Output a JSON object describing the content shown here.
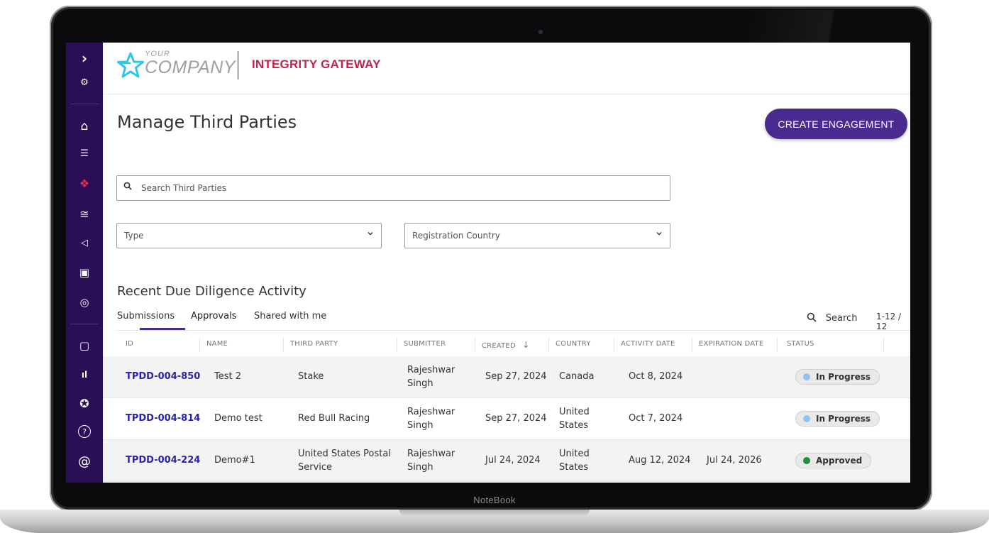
{
  "device": {
    "brand_label": "NoteBook"
  },
  "sidebar": {
    "items": [
      {
        "icon": "chevron-right-icon",
        "glyph": "›"
      },
      {
        "icon": "user-settings-icon",
        "glyph": "⚙"
      },
      {
        "icon": "home-icon",
        "glyph": "⌂"
      },
      {
        "icon": "checklist-icon",
        "glyph": "☰"
      },
      {
        "icon": "handshake-icon",
        "glyph": "❖"
      },
      {
        "icon": "layers-icon",
        "glyph": "≅"
      },
      {
        "icon": "megaphone-icon",
        "glyph": "◁"
      },
      {
        "icon": "money-icon",
        "glyph": "▣"
      },
      {
        "icon": "globe-search-icon",
        "glyph": "◎"
      },
      {
        "icon": "document-check-icon",
        "glyph": "▢"
      },
      {
        "icon": "bar-chart-icon",
        "glyph": "ıl"
      },
      {
        "icon": "shield-star-icon",
        "glyph": "✪"
      },
      {
        "icon": "help-icon",
        "glyph": "?"
      },
      {
        "icon": "at-sign-icon",
        "glyph": "@"
      }
    ]
  },
  "header": {
    "logo_small": "YOUR",
    "logo_large": "COMPANY",
    "product_name": "INTEGRITY GATEWAY"
  },
  "page": {
    "title": "Manage Third Parties",
    "create_button": "CREATE ENGAGEMENT",
    "search_placeholder": "Search Third Parties",
    "filter_type": "Type",
    "filter_country": "Registration Country"
  },
  "activity": {
    "title": "Recent Due Diligence Activity",
    "tabs": [
      "Submissions",
      "Approvals",
      "Shared with me"
    ],
    "active_tab": "Approvals",
    "search_label": "Search",
    "pager": "1-12 / 12",
    "columns": [
      "ID",
      "NAME",
      "THIRD PARTY",
      "SUBMITTER",
      "CREATED",
      "COUNTRY",
      "ACTIVITY DATE",
      "EXPIRATION DATE",
      "STATUS"
    ],
    "sort_indicator": "↓",
    "rows": [
      {
        "id": "TPDD-004-850",
        "name": "Test 2",
        "third_party": [
          "Stake"
        ],
        "submitter": [
          "Rajeshwar",
          "Singh"
        ],
        "created": "Sep 27, 2024",
        "country": [
          "Canada"
        ],
        "activity_date": "Oct 8, 2024",
        "expiration_date": "",
        "status": "In Progress",
        "status_color": "#8fc4f2"
      },
      {
        "id": "TPDD-004-814",
        "name": "Demo test",
        "third_party": [
          "Red Bull Racing"
        ],
        "submitter": [
          "Rajeshwar",
          "Singh"
        ],
        "created": "Sep 27, 2024",
        "country": [
          "United",
          "States"
        ],
        "activity_date": "Oct 7, 2024",
        "expiration_date": "",
        "status": "In Progress",
        "status_color": "#8fc4f2"
      },
      {
        "id": "TPDD-004-224",
        "name": "Demo#1",
        "third_party": [
          "United States Postal",
          "Service"
        ],
        "submitter": [
          "Rajeshwar",
          "Singh"
        ],
        "created": "Jul 24, 2024",
        "country": [
          "United",
          "States"
        ],
        "activity_date": "Aug 12, 2024",
        "expiration_date": "Jul 24, 2026",
        "status": "Approved",
        "status_color": "#1e8e3e"
      }
    ]
  },
  "colors": {
    "sidebar_bg": "#2a0f57",
    "accent": "#4b2a8f",
    "brand_red": "#c3224a",
    "link_blue": "#2b23a8"
  }
}
